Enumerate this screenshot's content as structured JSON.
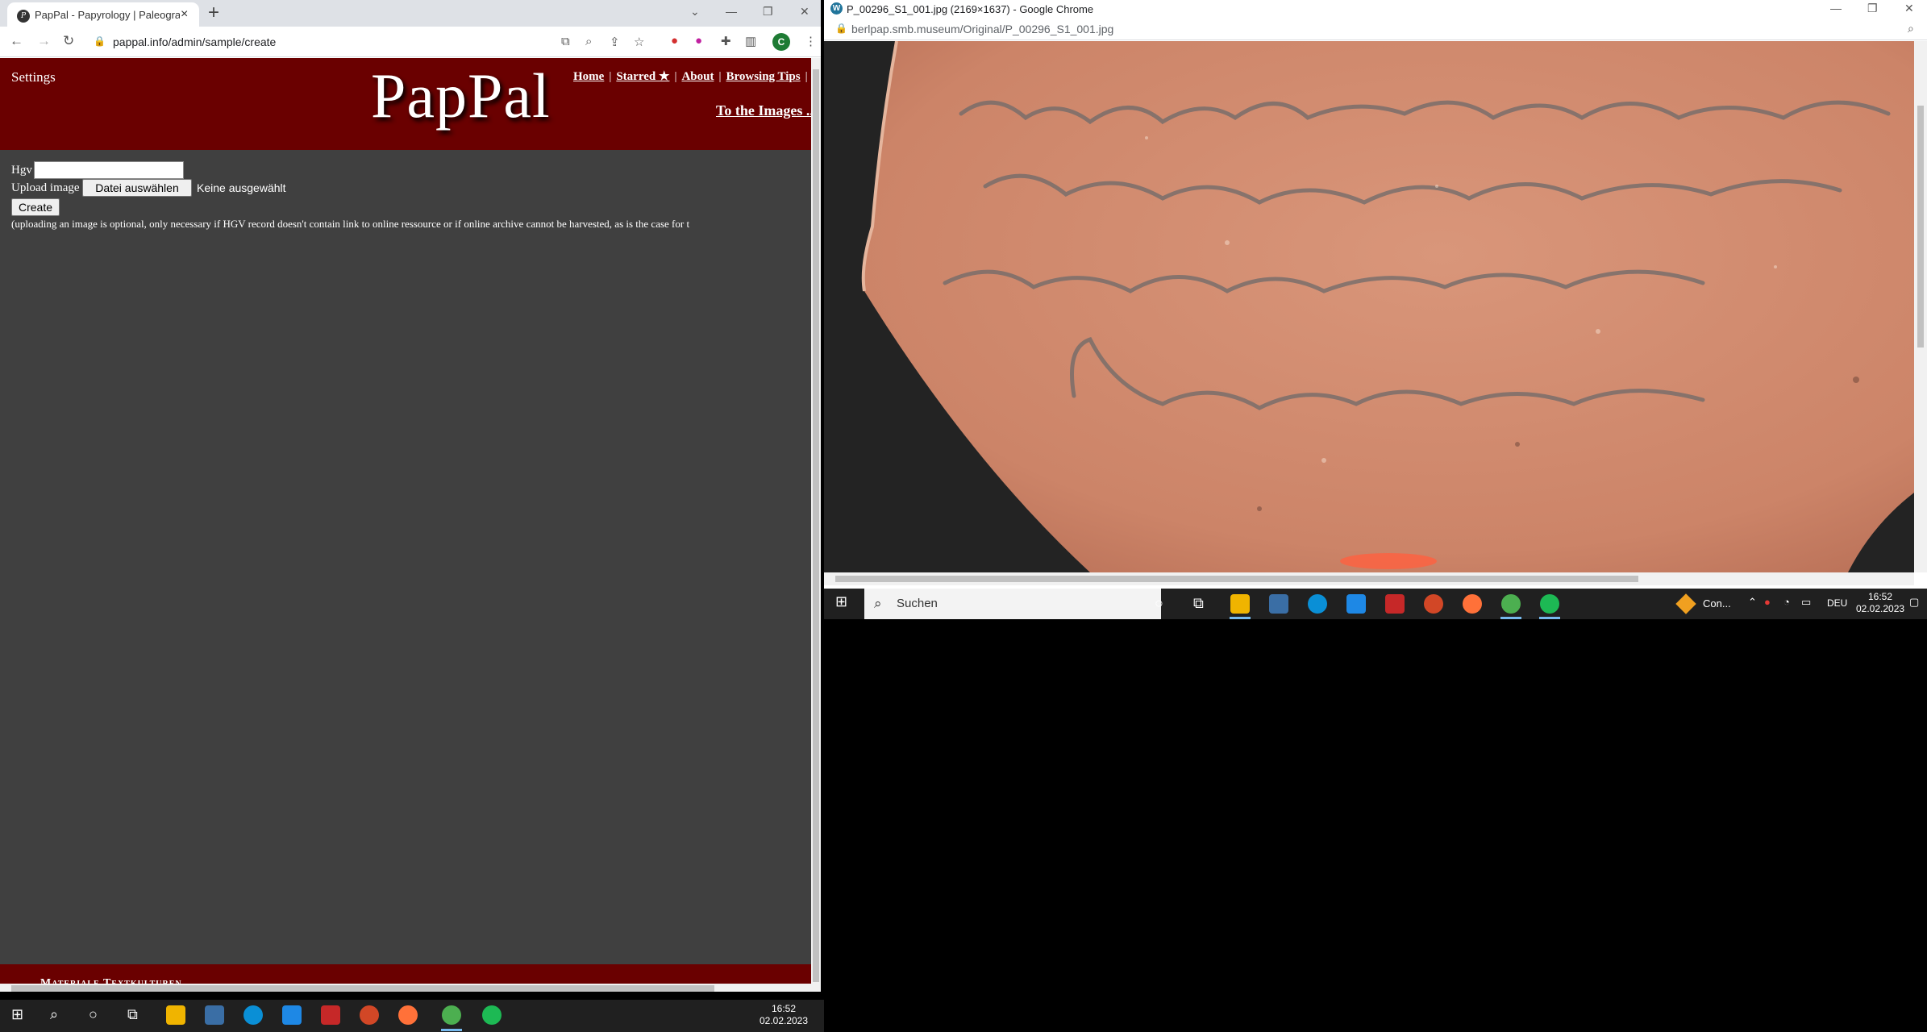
{
  "left_window": {
    "tab_title": "PapPal - Papyrology | Paleograph",
    "favicon": "P",
    "url": "pappal.info/admin/sample/create",
    "profile_initial": "C"
  },
  "page": {
    "settings_label": "Settings",
    "logo": "PapPal",
    "nav": {
      "home": "Home",
      "starred": "Starred ★",
      "about": "About",
      "browsing_tips": "Browsing Tips",
      "sep": "|"
    },
    "to_images": "To the Images ...",
    "form": {
      "hgv_label": "Hgv",
      "hgv_value": "",
      "upload_label": "Upload image",
      "file_button": "Datei auswählen",
      "file_status": "Keine ausgewählt",
      "create_button": "Create",
      "note": "(uploading an image is optional, only necessary if HGV record doesn't contain link to online ressource or if online archive cannot be harvested, as is the case for t"
    },
    "footer_text": "Materiale Textkulturen"
  },
  "right_window": {
    "title": "P_00296_S1_001.jpg (2169×1637) - Google Chrome",
    "favicon": "W",
    "url": "berlpap.smb.museum/Original/P_00296_S1_001.jpg"
  },
  "right_taskbar": {
    "search_placeholder": "Suchen",
    "notif_label": "Con...",
    "lang": "DEU",
    "time": "16:52",
    "date": "02.02.2023"
  },
  "main_taskbar": {
    "time": "16:52",
    "date": "02.02.2023"
  },
  "colors": {
    "header_red": "#6a0000",
    "page_bg": "#404040",
    "potsherd": "#d08a6a"
  }
}
